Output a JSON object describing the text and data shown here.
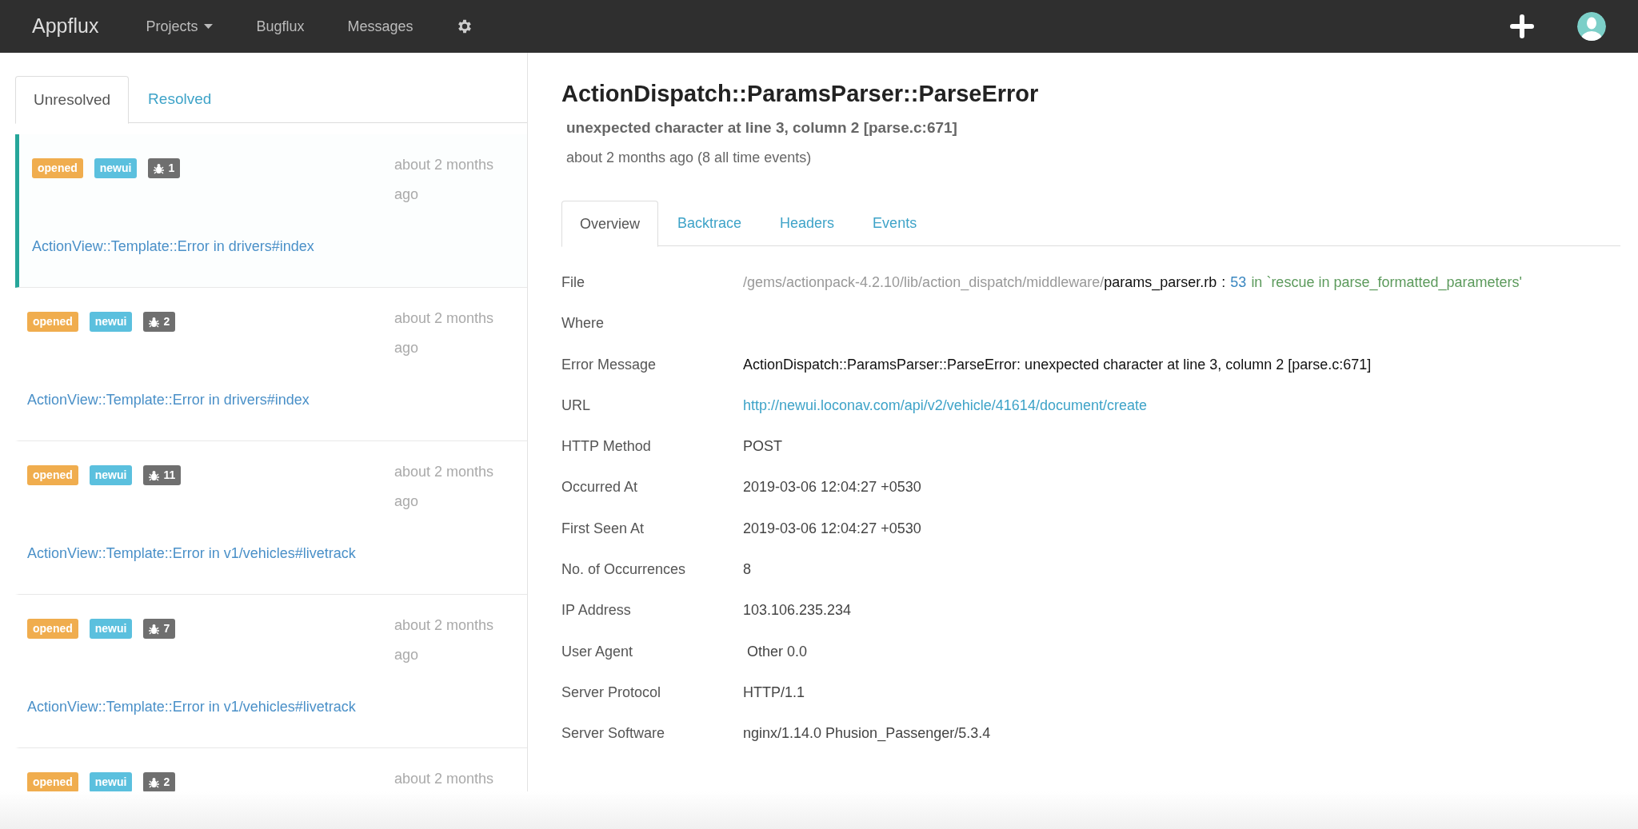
{
  "navbar": {
    "brand": "Appflux",
    "items": [
      {
        "kind": "dropdown",
        "label": "Projects"
      },
      {
        "kind": "link",
        "label": "Bugflux"
      },
      {
        "kind": "link",
        "label": "Messages"
      },
      {
        "kind": "settings"
      }
    ]
  },
  "list_tabs": [
    {
      "label": "Unresolved",
      "selected": true
    },
    {
      "label": "Resolved",
      "selected": false
    }
  ],
  "issues": [
    {
      "selected": true,
      "status": "opened",
      "project": "newui",
      "count": "1",
      "time": "about 2 months ago",
      "title": "ActionView::Template::Error in drivers#index"
    },
    {
      "selected": false,
      "status": "opened",
      "project": "newui",
      "count": "2",
      "time": "about 2 months ago",
      "title": "ActionView::Template::Error in drivers#index"
    },
    {
      "selected": false,
      "status": "opened",
      "project": "newui",
      "count": "11",
      "time": "about 2 months ago",
      "title": "ActionView::Template::Error in v1/vehicles#livetrack"
    },
    {
      "selected": false,
      "status": "opened",
      "project": "newui",
      "count": "7",
      "time": "about 2 months ago",
      "title": "ActionView::Template::Error in v1/vehicles#livetrack"
    },
    {
      "selected": false,
      "status": "opened",
      "project": "newui",
      "count": "2",
      "time": "about 2 months"
    }
  ],
  "detail": {
    "title": "ActionDispatch::ParamsParser::ParseError",
    "message": "unexpected character at line 3, column 2 [parse.c:671]",
    "meta": "about 2 months ago (8 all time events)",
    "tabs": [
      {
        "label": "Overview",
        "selected": true
      },
      {
        "label": "Backtrace",
        "selected": false
      },
      {
        "label": "Headers",
        "selected": false
      },
      {
        "label": "Events",
        "selected": false
      }
    ],
    "fields": [
      {
        "kind": "file",
        "label": "File",
        "path": "/gems/actionpack-4.2.10/lib/action_dispatch/middleware/",
        "file": "params_parser.rb",
        "separator": ":",
        "line": "53",
        "method": "in `rescue in parse_formatted_parameters'"
      },
      {
        "kind": "text",
        "label": "Where"
      },
      {
        "kind": "strong",
        "label": "Error Message",
        "value": "ActionDispatch::ParamsParser::ParseError: unexpected character at line 3, column 2 [parse.c:671]"
      },
      {
        "kind": "link",
        "label": "URL",
        "value": "http://newui.loconav.com/api/v2/vehicle/41614/document/create"
      },
      {
        "kind": "text",
        "label": "HTTP Method",
        "value": "POST"
      },
      {
        "kind": "text",
        "label": "Occurred At",
        "value": "2019-03-06 12:04:27 +0530"
      },
      {
        "kind": "text",
        "label": "First Seen At",
        "value": "2019-03-06 12:04:27 +0530"
      },
      {
        "kind": "text",
        "label": "No. of Occurrences",
        "value": "8"
      },
      {
        "kind": "text",
        "label": "IP Address",
        "value": "103.106.235.234"
      },
      {
        "kind": "text",
        "label": "User Agent",
        "value": " Other 0.0"
      },
      {
        "kind": "text",
        "label": "Server Protocol",
        "value": "HTTP/1.1"
      },
      {
        "kind": "text",
        "label": "Server Software",
        "value": "nginx/1.14.0 Phusion_Passenger/5.3.4"
      }
    ]
  }
}
